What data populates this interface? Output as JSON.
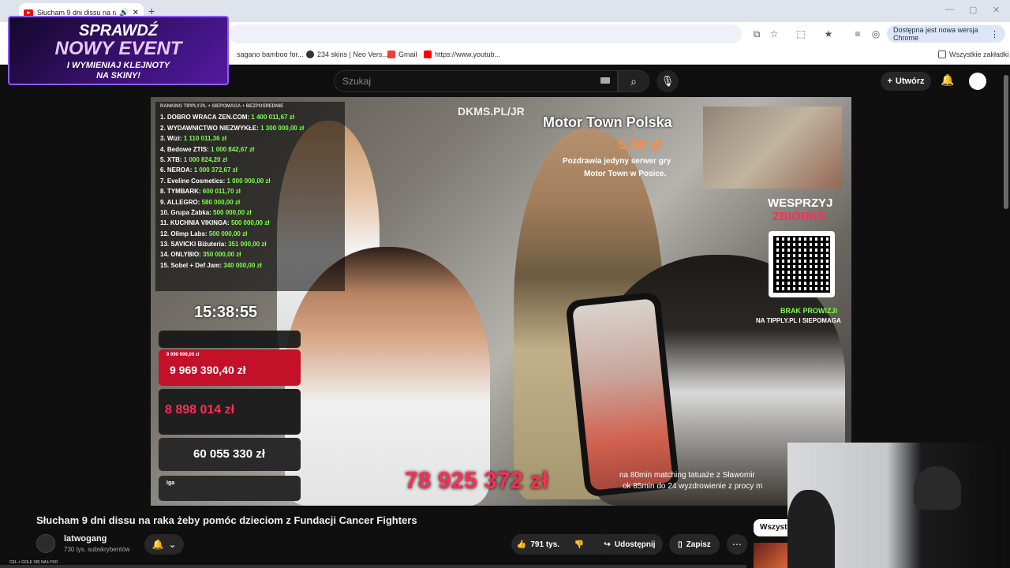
{
  "browser": {
    "tab_title": "Słucham 9 dni dissu na raka",
    "update_label": "Dostępna jest nowa wersja Chrome",
    "bookmarks": [
      "sagano bamboo for...",
      "234 skins | Neo Vers...",
      "Gmail",
      "https://www.youtub..."
    ],
    "all_bookmarks": "Wszystkie zakładki"
  },
  "youtube": {
    "search_placeholder": "Szukaj",
    "create_label": "Utwórz"
  },
  "stream_overlay": {
    "ranking_header": "RANKING   TIPPLY.PL + SIEPOMAGA + BEZPOŚREDNIE",
    "ranking": [
      {
        "name": "1. DOBRO WRACA ZEN.COM:",
        "amount": "1 400 011,67 zł"
      },
      {
        "name": "2. WYDAWNICTWO NIEZWYKŁE:",
        "amount": "1 300 000,00 zł"
      },
      {
        "name": "3. Wizi:",
        "amount": "1 110 011,36 zł"
      },
      {
        "name": "4. Bedowe ZTIS:",
        "amount": "1 000 842,67 zł"
      },
      {
        "name": "5. XTB:",
        "amount": "1 000 824,20 zł"
      },
      {
        "name": "6. NEROA:",
        "amount": "1 000 372,67 zł"
      },
      {
        "name": "7. Eveline Cosmetics:",
        "amount": "1 000 000,00 zł"
      },
      {
        "name": "8. TYMBARK:",
        "amount": "600 011,70 zł"
      },
      {
        "name": "9. ALLEGRO:",
        "amount": "580 000,00 zł"
      },
      {
        "name": "10. Grupa Żabka:",
        "amount": "500 000,00 zł"
      },
      {
        "name": "11. KUCHNIA VIKINGA:",
        "amount": "500 000,00 zł"
      },
      {
        "name": "12. Olimp Labs:",
        "amount": "500 000,00 zł"
      },
      {
        "name": "13. SAVICKI Biżuteria:",
        "amount": "351 000,00 zł"
      },
      {
        "name": "14. ONLYBIO:",
        "amount": "350 000,00 zł"
      },
      {
        "name": "15. Sobel + Def Jam:",
        "amount": "340 000,00 zł"
      }
    ],
    "clock": "15:38:55",
    "panel_small_total": "9 999 999,00 zł",
    "panel_total_1": "9 969 390,40 zł",
    "panel_total_2": "8 898 014 zł",
    "panel_total_3": "60 055 330 zł",
    "panel_bottom_label": "Iga",
    "grand_total": "78 925 372 zł",
    "dkms": "DKMS.PL/JR",
    "donor_title": "Motor Town Polska",
    "donor_amount": "5.00 zł",
    "donor_msg_1": "Pozdrawia jedyny serwer gry",
    "donor_msg_2": "Motor Town w Posice.",
    "support_1": "WESPRZYJ",
    "support_2": "ZBIÓRKĘ",
    "no_commission_1": "BRAK PROWIZJI",
    "no_commission_2": "NA TIPPLY.PL I SIEPOMAGA",
    "ticker_1": "na 80min matching tatuaże z Sławomir",
    "ticker_2": "ok 85min do 24 wyzdrowienie z procy m"
  },
  "video": {
    "title": "Słucham 9 dni dissu na raka żeby pomóc dzieciom z Fundacji Cancer Fighters",
    "channel": "latwogang",
    "subscribers": "730 tys. subskrybentów",
    "likes": "791 tys.",
    "share": "Udostępnij",
    "save": "Zapisz",
    "chip": "Wszystk"
  },
  "ad": {
    "line1": "SPRAWDŹ",
    "line2": "NOWY EVENT",
    "line3": "I WYMIENIAJ KLEJNOTY",
    "line4": "NA SKINY!"
  },
  "footer_small": "CEL + GOLE SIĘ NA ŁYSO"
}
